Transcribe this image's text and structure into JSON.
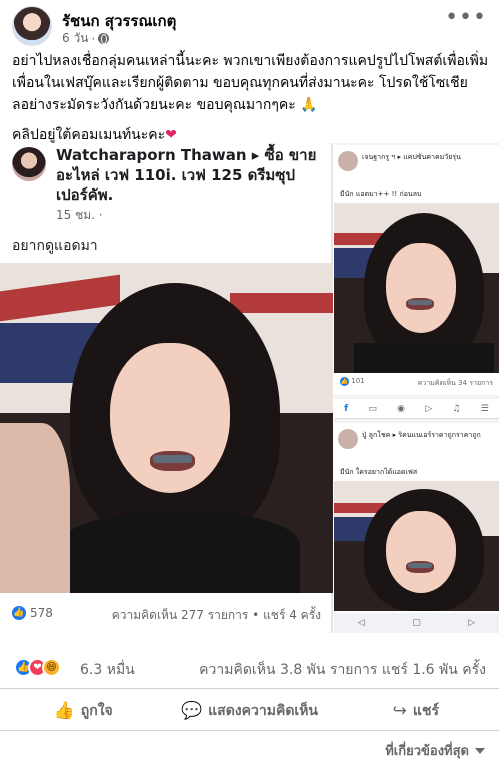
{
  "post": {
    "author": "รัชนก สุวรรณเกตุ",
    "time": "6 วัน",
    "more_glyph": "•••",
    "paragraphs": [
      "อย่าไปหลงเชื่อกลุ่มคนเหล่านี้นะคะ พวกเขาเพียงต้องการแคปรูปไปโพสต์เพื่อเพิ่มเพื่อนในเฟสบุ๊คและเรียกผู้ติดตาม ขอบคุณทุกคนที่ส่งมานะคะ โปรดใช้โซเชียลอย่างระมัดระวังกันด้วยนะคะ ขอบคุณมากๆคะ 🙏",
      "คลิปอยู่ใต้คอมเมนท์นะคะ"
    ],
    "heart_glyph": "❤"
  },
  "left_screenshot": {
    "name": "Watcharaporn Thawan ▸ ซื้อ ขาย อะไหล่ เวฟ 110i. เวฟ 125 ดรีมซุปเปอร์คัพ.",
    "time": "15 ชม. ·",
    "caption": "อยากดูแอดมา",
    "likes": "578",
    "stats": "ความคิดเห็น 277 รายการ • แชร์ 4 ครั้ง"
  },
  "right_screenshot_top": {
    "name": "เจนฐากรู ฯ ▸ แคปซันคาคมวัยรุ่น",
    "caption": "มีนัก แอดมา++ !! ก่อนลบ",
    "likes": "101",
    "stats": "ความคิดเห็น 34 รายการ"
  },
  "right_screenshot_nav": {
    "brand": "facebook",
    "icons": [
      "f",
      "▭",
      "◉",
      "▷",
      "♫",
      "☰"
    ]
  },
  "right_screenshot_bottom": {
    "name": "ปู่ ลูกโชค ▸ ริคนแนเอร์ราคาถูกราคาถูก",
    "caption": "มีนัก ใครอยากได้แอดเฟส",
    "nav_icons": [
      "◁",
      "▢",
      "▷"
    ]
  },
  "reactions": {
    "count": "6.3 หมื่น",
    "comments_shares": "ความคิดเห็น 3.8 พัน รายการ  แชร์ 1.6 พัน ครั้ง",
    "like_glyph": "👍",
    "love_glyph": "❤",
    "haha_glyph": "😆"
  },
  "actions": {
    "like_label": "ถูกใจ",
    "comment_label": "แสดงความคิดเห็น",
    "share_label": "แชร์",
    "like_icon": "👍",
    "comment_icon": "💬",
    "share_icon": "↪"
  },
  "sort": {
    "label": "ที่เกี่ยวข้องที่สุด"
  },
  "colors": {
    "brand_blue": "#1877f2",
    "love_red": "#f33e58",
    "haha_yellow": "#f7b125",
    "secondary_text": "#65676b"
  }
}
